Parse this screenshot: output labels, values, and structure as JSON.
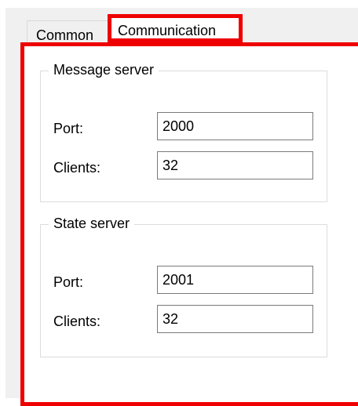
{
  "tabs": {
    "common_label": "Common",
    "communication_label": "Communication",
    "selected": "Communication"
  },
  "message_server": {
    "title": "Message server",
    "port_label": "Port:",
    "port_value": "2000",
    "clients_label": "Clients:",
    "clients_value": "32"
  },
  "state_server": {
    "title": "State server",
    "port_label": "Port:",
    "port_value": "2001",
    "clients_label": "Clients:",
    "clients_value": "32"
  },
  "colors": {
    "highlight": "#ee0000",
    "dialog_background": "#f0f0f0",
    "panel_background": "#ffffff",
    "input_border": "#7a7a7a"
  }
}
